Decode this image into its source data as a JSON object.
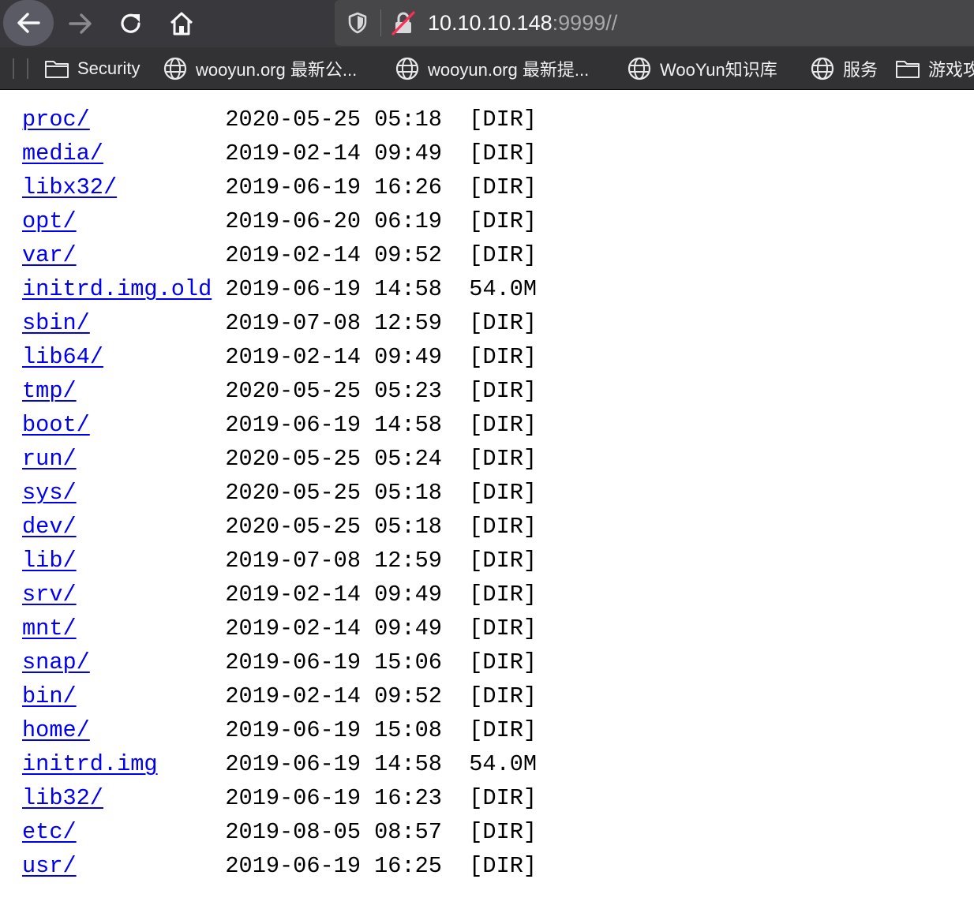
{
  "browser": {
    "url_host": "10.10.10.148",
    "url_rest": ":9999//"
  },
  "bookmarks": [
    {
      "label": "Security",
      "icon": "folder-icon"
    },
    {
      "label": "wooyun.org 最新公...",
      "icon": "globe-icon"
    },
    {
      "label": "wooyun.org 最新提...",
      "icon": "globe-icon"
    },
    {
      "label": "WooYun知识库",
      "icon": "globe-icon"
    },
    {
      "label": "服务",
      "icon": "globe-icon"
    },
    {
      "label": "游戏攻",
      "icon": "folder-icon"
    }
  ],
  "listing": [
    {
      "name": "proc/",
      "date": "2020-05-25 05:18",
      "size": "[DIR]"
    },
    {
      "name": "media/",
      "date": "2019-02-14 09:49",
      "size": "[DIR]"
    },
    {
      "name": "libx32/",
      "date": "2019-06-19 16:26",
      "size": "[DIR]"
    },
    {
      "name": "opt/",
      "date": "2019-06-20 06:19",
      "size": "[DIR]"
    },
    {
      "name": "var/",
      "date": "2019-02-14 09:52",
      "size": "[DIR]"
    },
    {
      "name": "initrd.img.old",
      "date": "2019-06-19 14:58",
      "size": "54.0M"
    },
    {
      "name": "sbin/",
      "date": "2019-07-08 12:59",
      "size": "[DIR]"
    },
    {
      "name": "lib64/",
      "date": "2019-02-14 09:49",
      "size": "[DIR]"
    },
    {
      "name": "tmp/",
      "date": "2020-05-25 05:23",
      "size": "[DIR]"
    },
    {
      "name": "boot/",
      "date": "2019-06-19 14:58",
      "size": "[DIR]"
    },
    {
      "name": "run/",
      "date": "2020-05-25 05:24",
      "size": "[DIR]"
    },
    {
      "name": "sys/",
      "date": "2020-05-25 05:18",
      "size": "[DIR]"
    },
    {
      "name": "dev/",
      "date": "2020-05-25 05:18",
      "size": "[DIR]"
    },
    {
      "name": "lib/",
      "date": "2019-07-08 12:59",
      "size": "[DIR]"
    },
    {
      "name": "srv/",
      "date": "2019-02-14 09:49",
      "size": "[DIR]"
    },
    {
      "name": "mnt/",
      "date": "2019-02-14 09:49",
      "size": "[DIR]"
    },
    {
      "name": "snap/",
      "date": "2019-06-19 15:06",
      "size": "[DIR]"
    },
    {
      "name": "bin/",
      "date": "2019-02-14 09:52",
      "size": "[DIR]"
    },
    {
      "name": "home/",
      "date": "2019-06-19 15:08",
      "size": "[DIR]"
    },
    {
      "name": "initrd.img",
      "date": "2019-06-19 14:58",
      "size": "54.0M"
    },
    {
      "name": "lib32/",
      "date": "2019-06-19 16:23",
      "size": "[DIR]"
    },
    {
      "name": "etc/",
      "date": "2019-08-05 08:57",
      "size": "[DIR]"
    },
    {
      "name": "usr/",
      "date": "2019-06-19 16:25",
      "size": "[DIR]"
    }
  ]
}
